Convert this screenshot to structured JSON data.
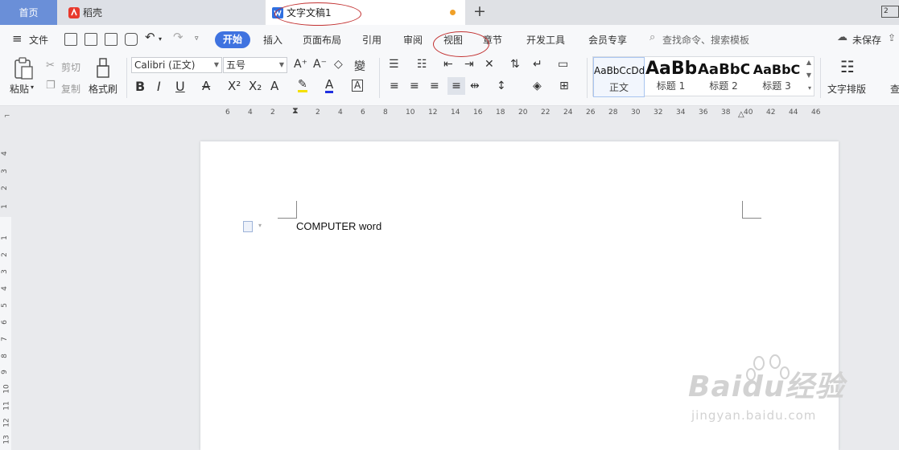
{
  "tabs": {
    "home": "首页",
    "daoke": "稻壳",
    "document": "文字文稿1",
    "new_tab": "+",
    "window_num": "2"
  },
  "menu": {
    "file": "文件",
    "start": "开始",
    "insert": "插入",
    "layout": "页面布局",
    "reference": "引用",
    "review": "审阅",
    "view": "视图",
    "chapter": "章节",
    "devtools": "开发工具",
    "member": "会员专享",
    "search_placeholder": "查找命令、搜索模板",
    "unsaved": "未保存"
  },
  "ribbon": {
    "paste": "粘贴",
    "cut": "剪切",
    "copy": "复制",
    "format_painter": "格式刷",
    "font_name": "Calibri (正文)",
    "font_size": "五号",
    "styles": [
      {
        "sample": "AaBbCcDd",
        "label": "正文"
      },
      {
        "sample": "AaBb",
        "label": "标题 1"
      },
      {
        "sample": "AaBbC",
        "label": "标题 2"
      },
      {
        "sample": "AaBbC",
        "label": "标题 3"
      }
    ],
    "text_layout": "文字排版",
    "find": "查"
  },
  "ruler": {
    "h": [
      "6",
      "4",
      "2",
      "2",
      "4",
      "6",
      "8",
      "10",
      "12",
      "14",
      "16",
      "18",
      "20",
      "22",
      "24",
      "26",
      "28",
      "30",
      "32",
      "34",
      "36",
      "38",
      "40",
      "42",
      "44",
      "46"
    ],
    "v": [
      "4",
      "3",
      "2",
      "1",
      "1",
      "2",
      "3",
      "4",
      "5",
      "6",
      "7",
      "8",
      "9",
      "10",
      "11",
      "12",
      "13"
    ]
  },
  "document": {
    "body_text": "COMPUTER word"
  },
  "watermark": {
    "brand": "Baidu经验",
    "url": "jingyan.baidu.com"
  },
  "colors": {
    "accent": "#3f73e0",
    "home_tab": "#6a8fd8",
    "annotation": "#c23030",
    "unsaved_dot": "#f0a028"
  }
}
